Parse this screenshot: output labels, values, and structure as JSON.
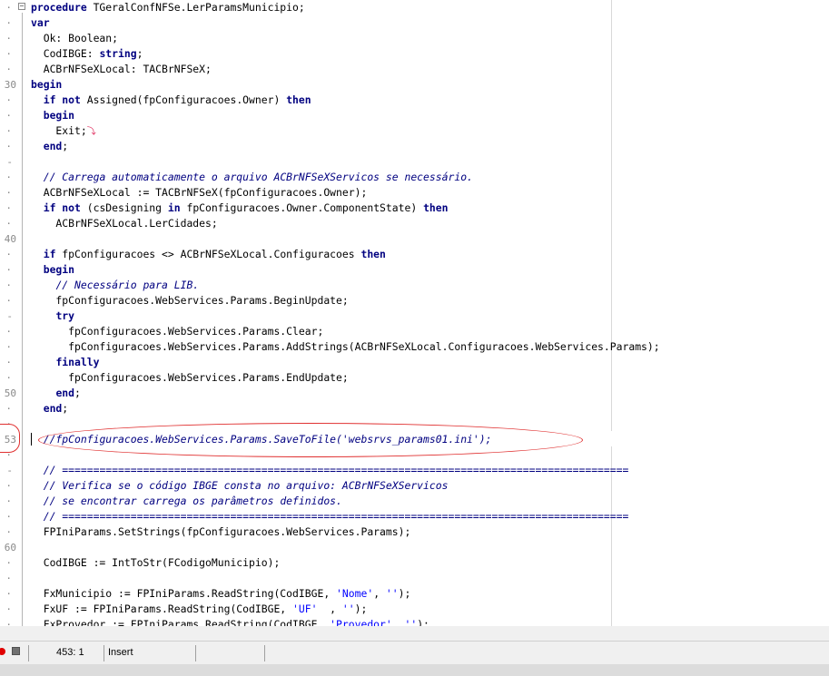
{
  "gutter_numbers": [
    {
      "line": 5,
      "text": "30"
    },
    {
      "line": 15,
      "text": "40"
    },
    {
      "line": 25,
      "text": "50"
    },
    {
      "line": 28,
      "text": "53"
    },
    {
      "line": 35,
      "text": "60"
    }
  ],
  "lines": [
    [
      {
        "t": "procedure ",
        "c": "kw"
      },
      {
        "t": "TGeralConfNFSe.LerParamsMunicipio;"
      }
    ],
    [
      {
        "t": "var",
        "c": "kw"
      }
    ],
    [
      {
        "t": "  Ok: Boolean;"
      }
    ],
    [
      {
        "t": "  CodIBGE: "
      },
      {
        "t": "string",
        "c": "kw"
      },
      {
        "t": ";"
      }
    ],
    [
      {
        "t": "  ACBrNFSeXLocal: TACBrNFSeX;"
      }
    ],
    [
      {
        "t": "begin",
        "c": "kw"
      }
    ],
    [
      {
        "t": "  "
      },
      {
        "t": "if not",
        "c": "kw"
      },
      {
        "t": " Assigned(fpConfiguracoes.Owner) "
      },
      {
        "t": "then",
        "c": "kw"
      }
    ],
    [
      {
        "t": "  "
      },
      {
        "t": "begin",
        "c": "kw"
      }
    ],
    [
      {
        "t": "    Exit;"
      }
    ],
    [
      {
        "t": "  "
      },
      {
        "t": "end",
        "c": "kw"
      },
      {
        "t": ";"
      }
    ],
    [
      {
        "t": ""
      }
    ],
    [
      {
        "t": "  "
      },
      {
        "t": "// Carrega automaticamente o arquivo ACBrNFSeXServicos se necessário.",
        "c": "cm"
      }
    ],
    [
      {
        "t": "  ACBrNFSeXLocal := TACBrNFSeX(fpConfiguracoes.Owner);"
      }
    ],
    [
      {
        "t": "  "
      },
      {
        "t": "if not",
        "c": "kw"
      },
      {
        "t": " (csDesigning "
      },
      {
        "t": "in",
        "c": "kw"
      },
      {
        "t": " fpConfiguracoes.Owner.ComponentState) "
      },
      {
        "t": "then",
        "c": "kw"
      }
    ],
    [
      {
        "t": "    ACBrNFSeXLocal.LerCidades;"
      }
    ],
    [
      {
        "t": ""
      }
    ],
    [
      {
        "t": "  "
      },
      {
        "t": "if",
        "c": "kw"
      },
      {
        "t": " fpConfiguracoes <> ACBrNFSeXLocal.Configuracoes "
      },
      {
        "t": "then",
        "c": "kw"
      }
    ],
    [
      {
        "t": "  "
      },
      {
        "t": "begin",
        "c": "kw"
      }
    ],
    [
      {
        "t": "    "
      },
      {
        "t": "// Necessário para LIB.",
        "c": "cm"
      }
    ],
    [
      {
        "t": "    fpConfiguracoes.WebServices.Params.BeginUpdate;"
      }
    ],
    [
      {
        "t": "    "
      },
      {
        "t": "try",
        "c": "kw"
      }
    ],
    [
      {
        "t": "      fpConfiguracoes.WebServices.Params.Clear;"
      }
    ],
    [
      {
        "t": "      fpConfiguracoes.WebServices.Params.AddStrings(ACBrNFSeXLocal.Configuracoes.WebServices.Params);"
      }
    ],
    [
      {
        "t": "    "
      },
      {
        "t": "finally",
        "c": "kw"
      }
    ],
    [
      {
        "t": "      fpConfiguracoes.WebServices.Params.EndUpdate;"
      }
    ],
    [
      {
        "t": "    "
      },
      {
        "t": "end",
        "c": "kw"
      },
      {
        "t": ";"
      }
    ],
    [
      {
        "t": "  "
      },
      {
        "t": "end",
        "c": "kw"
      },
      {
        "t": ";"
      }
    ],
    [
      {
        "t": ""
      }
    ],
    [
      {
        "t": "  "
      },
      {
        "t": "//fpConfiguracoes.WebServices.Params.SaveToFile('websrvs_params01.ini');",
        "c": "cm"
      }
    ],
    [
      {
        "t": ""
      }
    ],
    [
      {
        "t": "  "
      },
      {
        "t": "// ===========================================================================================",
        "c": "cm"
      }
    ],
    [
      {
        "t": "  "
      },
      {
        "t": "// Verifica se o código IBGE consta no arquivo: ACBrNFSeXServicos",
        "c": "cm"
      }
    ],
    [
      {
        "t": "  "
      },
      {
        "t": "// se encontrar carrega os parâmetros definidos.",
        "c": "cm"
      }
    ],
    [
      {
        "t": "  "
      },
      {
        "t": "// ===========================================================================================",
        "c": "cm"
      }
    ],
    [
      {
        "t": "  FPIniParams.SetStrings(fpConfiguracoes.WebServices.Params);"
      }
    ],
    [
      {
        "t": ""
      }
    ],
    [
      {
        "t": "  CodIBGE := IntToStr(FCodigoMunicipio);"
      }
    ],
    [
      {
        "t": ""
      }
    ],
    [
      {
        "t": "  FxMunicipio := FPIniParams.ReadString(CodIBGE, "
      },
      {
        "t": "'Nome'",
        "c": "st"
      },
      {
        "t": ", "
      },
      {
        "t": "''",
        "c": "st"
      },
      {
        "t": ");"
      }
    ],
    [
      {
        "t": "  FxUF := FPIniParams.ReadString(CodIBGE, "
      },
      {
        "t": "'UF'",
        "c": "st"
      },
      {
        "t": "  , "
      },
      {
        "t": "''",
        "c": "st"
      },
      {
        "t": ");"
      }
    ],
    [
      {
        "t": "  FxProvedor := FPIniParams.ReadString(CodIBGE, "
      },
      {
        "t": "'Provedor'",
        "c": "st"
      },
      {
        "t": ", "
      },
      {
        "t": "''",
        "c": "st"
      },
      {
        "t": ");"
      }
    ]
  ],
  "status": {
    "position": "453:  1",
    "mode": "Insert"
  },
  "colors": {
    "keyword": "#000080",
    "comment": "#000080",
    "string": "#0000ff",
    "annotation": "#e03030"
  }
}
